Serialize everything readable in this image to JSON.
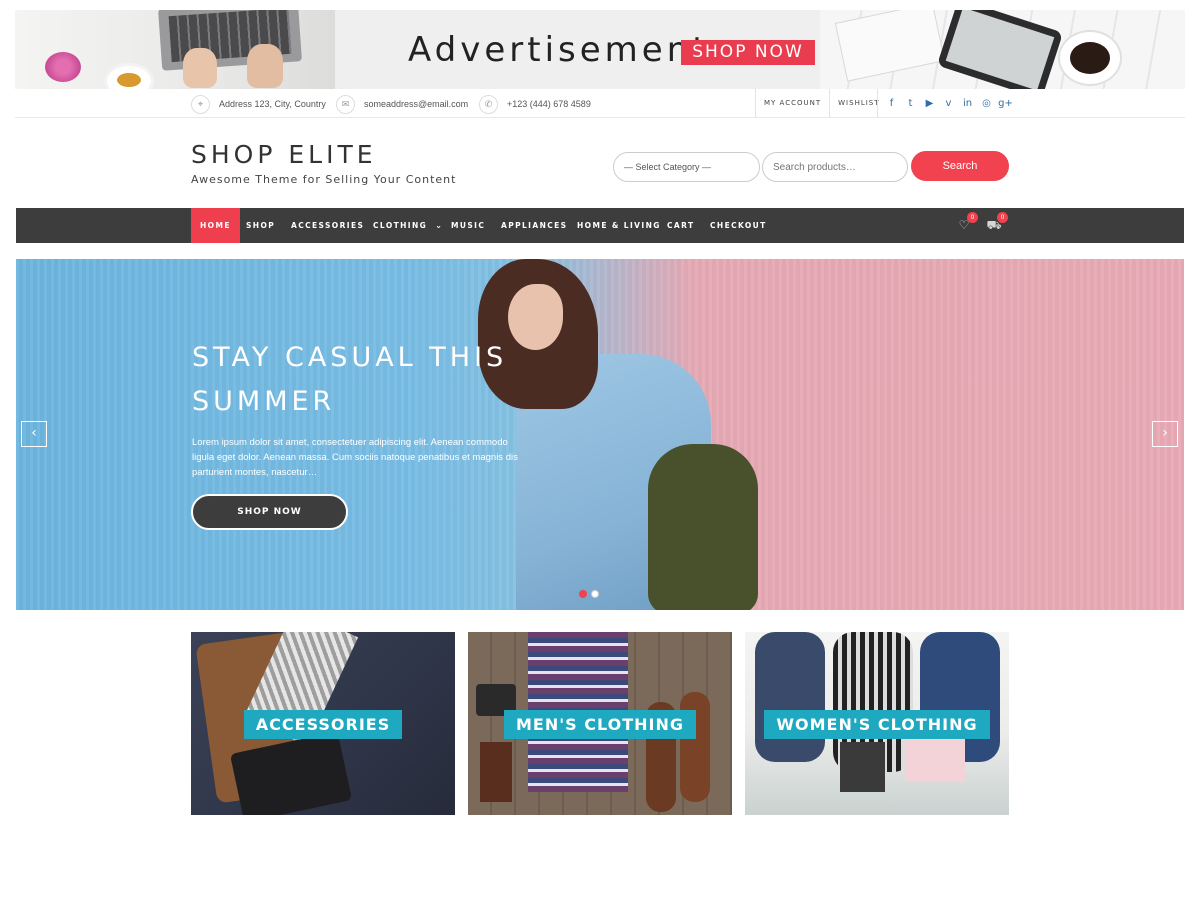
{
  "ad": {
    "text": "Advertisement",
    "shop_label": "SHOP NOW"
  },
  "topbar": {
    "address": "Address 123, City, Country",
    "email": "someaddress@email.com",
    "phone": "+123 (444) 678 4589",
    "my_account": "MY ACCOUNT",
    "wishlist": "WISHLIST",
    "social": [
      "f",
      "t",
      "▶",
      "v",
      "in",
      "◎",
      "g+"
    ]
  },
  "header": {
    "title": "SHOP ELITE",
    "tagline": "Awesome Theme for Selling Your Content",
    "category_select": "— Select Category —",
    "search_placeholder": "Search products…",
    "search_label": "Search"
  },
  "nav": {
    "items": [
      "HOME",
      "SHOP",
      "ACCESSORIES",
      "CLOTHING",
      "MUSIC",
      "APPLIANCES",
      "HOME & LIVING",
      "CART",
      "CHECKOUT"
    ],
    "wishlist_count": "0",
    "cart_count": "0"
  },
  "hero": {
    "title": "STAY CASUAL THIS SUMMER",
    "text": "Lorem ipsum dolor sit amet, consectetuer adipiscing elit. Aenean commodo ligula eget dolor. Aenean massa. Cum sociis natoque penatibus et magnis dis parturient montes, nascetur…",
    "button": "SHOP NOW"
  },
  "categories": [
    "ACCESSORIES",
    "MEN'S CLOTHING",
    "WOMEN'S CLOTHING"
  ],
  "colors": {
    "accent": "#f2414f",
    "nav_bg": "#3d3d3d",
    "tile_label": "#1fa9c1"
  }
}
